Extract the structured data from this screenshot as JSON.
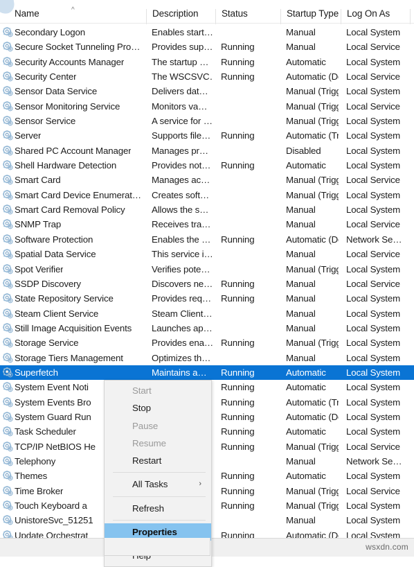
{
  "columns": [
    {
      "key": "name",
      "label": "Name"
    },
    {
      "key": "description",
      "label": "Description"
    },
    {
      "key": "status",
      "label": "Status"
    },
    {
      "key": "startup_type",
      "label": "Startup Type"
    },
    {
      "key": "log_on_as",
      "label": "Log On As"
    }
  ],
  "sort_indicator": "^",
  "colors": {
    "selection_blue": "#0a74d4",
    "menu_highlight_blue": "#85c3ef",
    "menu_background": "#f2f2f2",
    "icon_blue": "#7fa8cc"
  },
  "rows": [
    {
      "name": "Secondary Logon",
      "description": "Enables start…",
      "status": "",
      "startup_type": "Manual",
      "log_on_as": "Local System",
      "selected": false
    },
    {
      "name": "Secure Socket Tunneling Pro…",
      "description": "Provides sup…",
      "status": "Running",
      "startup_type": "Manual",
      "log_on_as": "Local Service",
      "selected": false
    },
    {
      "name": "Security Accounts Manager",
      "description": "The startup …",
      "status": "Running",
      "startup_type": "Automatic",
      "log_on_as": "Local System",
      "selected": false
    },
    {
      "name": "Security Center",
      "description": "The WSCSVC…",
      "status": "Running",
      "startup_type": "Automatic (De…",
      "log_on_as": "Local Service",
      "selected": false
    },
    {
      "name": "Sensor Data Service",
      "description": "Delivers dat…",
      "status": "",
      "startup_type": "Manual (Trigg…",
      "log_on_as": "Local System",
      "selected": false
    },
    {
      "name": "Sensor Monitoring Service",
      "description": "Monitors va…",
      "status": "",
      "startup_type": "Manual (Trigg…",
      "log_on_as": "Local Service",
      "selected": false
    },
    {
      "name": "Sensor Service",
      "description": "A service for …",
      "status": "",
      "startup_type": "Manual (Trigg…",
      "log_on_as": "Local System",
      "selected": false
    },
    {
      "name": "Server",
      "description": "Supports file…",
      "status": "Running",
      "startup_type": "Automatic (Tri…",
      "log_on_as": "Local System",
      "selected": false
    },
    {
      "name": "Shared PC Account Manager",
      "description": "Manages pr…",
      "status": "",
      "startup_type": "Disabled",
      "log_on_as": "Local System",
      "selected": false
    },
    {
      "name": "Shell Hardware Detection",
      "description": "Provides not…",
      "status": "Running",
      "startup_type": "Automatic",
      "log_on_as": "Local System",
      "selected": false
    },
    {
      "name": "Smart Card",
      "description": "Manages ac…",
      "status": "",
      "startup_type": "Manual (Trigg…",
      "log_on_as": "Local Service",
      "selected": false
    },
    {
      "name": "Smart Card Device Enumerat…",
      "description": "Creates soft…",
      "status": "",
      "startup_type": "Manual (Trigg…",
      "log_on_as": "Local System",
      "selected": false
    },
    {
      "name": "Smart Card Removal Policy",
      "description": "Allows the s…",
      "status": "",
      "startup_type": "Manual",
      "log_on_as": "Local System",
      "selected": false
    },
    {
      "name": "SNMP Trap",
      "description": "Receives tra…",
      "status": "",
      "startup_type": "Manual",
      "log_on_as": "Local Service",
      "selected": false
    },
    {
      "name": "Software Protection",
      "description": "Enables the …",
      "status": "Running",
      "startup_type": "Automatic (De…",
      "log_on_as": "Network Se…",
      "selected": false
    },
    {
      "name": "Spatial Data Service",
      "description": "This service i…",
      "status": "",
      "startup_type": "Manual",
      "log_on_as": "Local Service",
      "selected": false
    },
    {
      "name": "Spot Verifier",
      "description": "Verifies pote…",
      "status": "",
      "startup_type": "Manual (Trigg…",
      "log_on_as": "Local System",
      "selected": false
    },
    {
      "name": "SSDP Discovery",
      "description": "Discovers ne…",
      "status": "Running",
      "startup_type": "Manual",
      "log_on_as": "Local Service",
      "selected": false
    },
    {
      "name": "State Repository Service",
      "description": "Provides req…",
      "status": "Running",
      "startup_type": "Manual",
      "log_on_as": "Local System",
      "selected": false
    },
    {
      "name": "Steam Client Service",
      "description": "Steam Client…",
      "status": "",
      "startup_type": "Manual",
      "log_on_as": "Local System",
      "selected": false
    },
    {
      "name": "Still Image Acquisition Events",
      "description": "Launches ap…",
      "status": "",
      "startup_type": "Manual",
      "log_on_as": "Local System",
      "selected": false
    },
    {
      "name": "Storage Service",
      "description": "Provides ena…",
      "status": "Running",
      "startup_type": "Manual (Trigg…",
      "log_on_as": "Local System",
      "selected": false
    },
    {
      "name": "Storage Tiers Management",
      "description": "Optimizes th…",
      "status": "",
      "startup_type": "Manual",
      "log_on_as": "Local System",
      "selected": false
    },
    {
      "name": "Superfetch",
      "description": "Maintains a…",
      "status": "Running",
      "startup_type": "Automatic",
      "log_on_as": "Local System",
      "selected": true
    },
    {
      "name": "System Event Noti",
      "description": "",
      "status": "Running",
      "startup_type": "Automatic",
      "log_on_as": "Local System",
      "selected": false
    },
    {
      "name": "System Events Bro",
      "description": "",
      "status": "Running",
      "startup_type": "Automatic (Tri…",
      "log_on_as": "Local System",
      "selected": false
    },
    {
      "name": "System Guard Run",
      "description": "",
      "status": "Running",
      "startup_type": "Automatic (De…",
      "log_on_as": "Local System",
      "selected": false
    },
    {
      "name": "Task Scheduler",
      "description": "",
      "status": "Running",
      "startup_type": "Automatic",
      "log_on_as": "Local System",
      "selected": false
    },
    {
      "name": "TCP/IP NetBIOS He",
      "description": "",
      "status": "Running",
      "startup_type": "Manual (Trigg…",
      "log_on_as": "Local Service",
      "selected": false
    },
    {
      "name": "Telephony",
      "description": "",
      "status": "",
      "startup_type": "Manual",
      "log_on_as": "Network Se…",
      "selected": false
    },
    {
      "name": "Themes",
      "description": "",
      "status": "Running",
      "startup_type": "Automatic",
      "log_on_as": "Local System",
      "selected": false
    },
    {
      "name": "Time Broker",
      "description": "",
      "status": "Running",
      "startup_type": "Manual (Trigg…",
      "log_on_as": "Local Service",
      "selected": false
    },
    {
      "name": "Touch Keyboard a",
      "description": "",
      "status": "Running",
      "startup_type": "Manual (Trigg…",
      "log_on_as": "Local System",
      "selected": false
    },
    {
      "name": "UnistoreSvc_51251",
      "description": "",
      "status": "",
      "startup_type": "Manual",
      "log_on_as": "Local System",
      "selected": false
    },
    {
      "name": "Update Orchestrat",
      "description": "",
      "status": "Running",
      "startup_type": "Automatic (De…",
      "log_on_as": "Local System",
      "selected": false
    }
  ],
  "context_menu": {
    "items": [
      {
        "label": "Start",
        "state": "disabled",
        "submenu": false
      },
      {
        "label": "Stop",
        "state": "enabled",
        "submenu": false
      },
      {
        "label": "Pause",
        "state": "disabled",
        "submenu": false
      },
      {
        "label": "Resume",
        "state": "disabled",
        "submenu": false
      },
      {
        "label": "Restart",
        "state": "enabled",
        "submenu": false
      },
      {
        "label": "__sep__",
        "state": "separator",
        "submenu": false
      },
      {
        "label": "All Tasks",
        "state": "enabled",
        "submenu": true
      },
      {
        "label": "__sep__",
        "state": "separator",
        "submenu": false
      },
      {
        "label": "Refresh",
        "state": "enabled",
        "submenu": false
      },
      {
        "label": "__sep__",
        "state": "separator",
        "submenu": false
      },
      {
        "label": "Properties",
        "state": "highlight",
        "submenu": false
      },
      {
        "label": "__sep__",
        "state": "separator",
        "submenu": false
      },
      {
        "label": "Help",
        "state": "enabled",
        "submenu": false
      }
    ],
    "submenu_arrow": "›"
  },
  "watermark": "wsxdn.com"
}
